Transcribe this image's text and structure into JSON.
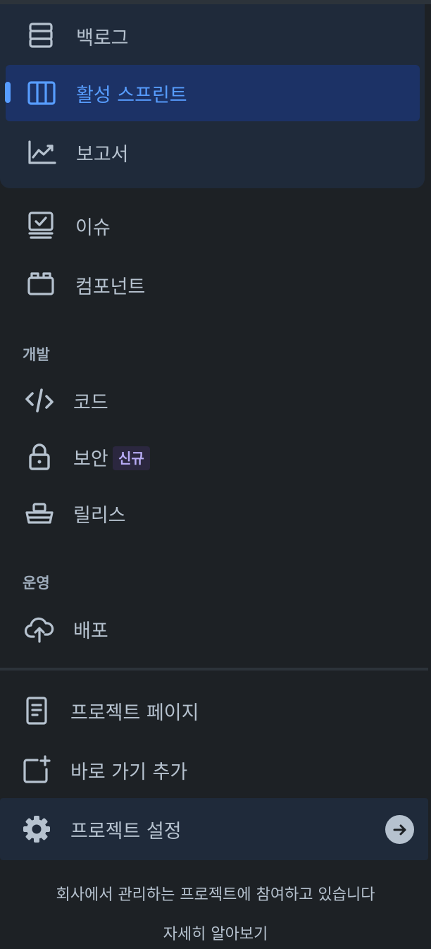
{
  "colors": {
    "background": "#1d2125",
    "group_background": "#1f2a3a",
    "active_background": "#1c3266",
    "accent": "#579dff",
    "text": "#b6c2cf",
    "badge_background": "#2b273f",
    "badge_text": "#b8acf6"
  },
  "planning": {
    "items": [
      {
        "label": "백로그",
        "icon": "backlog-icon",
        "active": false
      },
      {
        "label": "활성 스프린트",
        "icon": "board-columns-icon",
        "active": true
      },
      {
        "label": "보고서",
        "icon": "chart-line-icon",
        "active": false
      }
    ]
  },
  "general": {
    "items": [
      {
        "label": "이슈",
        "icon": "issues-monitor-icon"
      },
      {
        "label": "컴포넌트",
        "icon": "component-icon"
      }
    ]
  },
  "development": {
    "header": "개발",
    "items": [
      {
        "label": "코드",
        "icon": "code-icon"
      },
      {
        "label": "보안",
        "icon": "lock-icon",
        "badge": "신규"
      },
      {
        "label": "릴리스",
        "icon": "ship-icon"
      }
    ]
  },
  "operations": {
    "header": "운영",
    "items": [
      {
        "label": "배포",
        "icon": "cloud-upload-icon"
      }
    ]
  },
  "project": {
    "items": [
      {
        "label": "프로젝트 페이지",
        "icon": "page-icon"
      },
      {
        "label": "바로 가기 추가",
        "icon": "add-shortcut-icon"
      },
      {
        "label": "프로젝트 설정",
        "icon": "gear-icon",
        "action_icon": "arrow-right-circle-icon"
      }
    ]
  },
  "footer": {
    "message": "회사에서 관리하는 프로젝트에 참여하고 있습니다",
    "link": "자세히 알아보기"
  }
}
